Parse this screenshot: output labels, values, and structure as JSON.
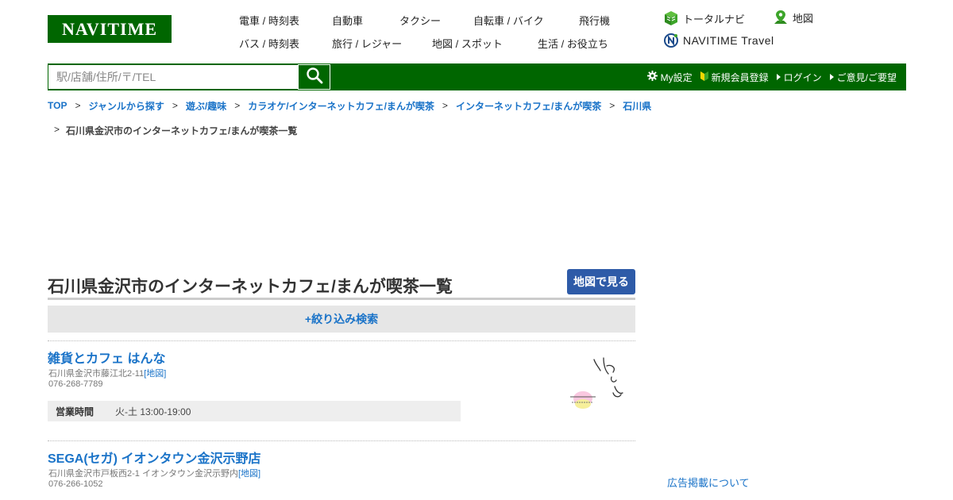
{
  "header": {
    "logo_text": "NAVITIME",
    "nav_row1": [
      "電車 / 時刻表",
      "自動車",
      "タクシー",
      "自転車 / バイク",
      "飛行機"
    ],
    "nav_row2": [
      "バス / 時刻表",
      "旅行 / レジャー",
      "地図 / スポット",
      "生活 / お役立ち"
    ],
    "total_navi": "トータルナビ",
    "map": "地図",
    "travel": "NAVITIME Travel"
  },
  "search": {
    "placeholder": "駅/店舗/住所/〒/TEL"
  },
  "userlinks": {
    "my_settings": "My設定",
    "register": "新規会員登録",
    "login": "ログイン",
    "feedback": "ご意見/ご要望"
  },
  "breadcrumb": {
    "items": [
      "TOP",
      "ジャンルから探す",
      "遊ぶ/趣味",
      "カラオケ/インターネットカフェ/まんが喫茶",
      "インターネットカフェ/まんが喫茶",
      "石川県"
    ],
    "separator": ">",
    "current": "石川県金沢市のインターネットカフェ/まんが喫茶一覧"
  },
  "main": {
    "title": "石川県金沢市のインターネットカフェ/まんが喫茶一覧",
    "map_button": "地図で見る",
    "filter_label": "+絞り込み検索"
  },
  "shops": [
    {
      "name": "雑貨とカフェ はんな",
      "address": "石川県金沢市藤江北2-11",
      "map_link": "[地図]",
      "tel": "076-268-7789",
      "hours_label": "営業時間",
      "hours": "火-土 13:00-19:00"
    },
    {
      "name": "SEGA(セガ) イオンタウン金沢示野店",
      "address": "石川県金沢市戸板西2-1 イオンタウン金沢示野内",
      "map_link": "[地図]",
      "tel": "076-266-1052"
    }
  ],
  "sidebar": {
    "ad_link": "広告掲載について"
  },
  "colors": {
    "brand_green": "#006600",
    "link_blue": "#1a73c8",
    "map_button": "#2e5ba8"
  }
}
